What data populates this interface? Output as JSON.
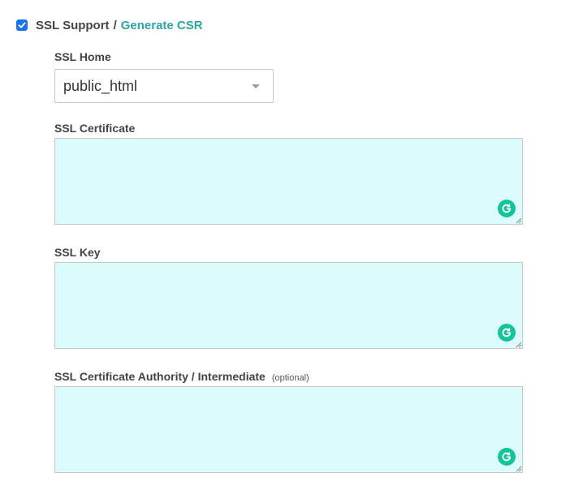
{
  "header": {
    "ssl_support_label": "SSL Support",
    "separator": "/",
    "generate_csr_label": "Generate CSR",
    "ssl_support_checked": true,
    "checkbox_color": "#1a73e8",
    "link_color": "#2ba5a1"
  },
  "ssl_home": {
    "label": "SSL Home",
    "selected_value": "public_html"
  },
  "ssl_certificate": {
    "label": "SSL Certificate",
    "value": "",
    "background_color": "#dcfbfd"
  },
  "ssl_key": {
    "label": "SSL Key",
    "value": "",
    "background_color": "#dcfbfd"
  },
  "ssl_ca": {
    "label": "SSL Certificate Authority / Intermediate",
    "optional_note": "(optional)",
    "value": "",
    "background_color": "#dcfbfd"
  },
  "icons": {
    "checkbox": "checkmark-icon",
    "dropdown": "caret-down-icon",
    "grammar": "grammarly-icon",
    "grammar_color": "#15c39a"
  }
}
